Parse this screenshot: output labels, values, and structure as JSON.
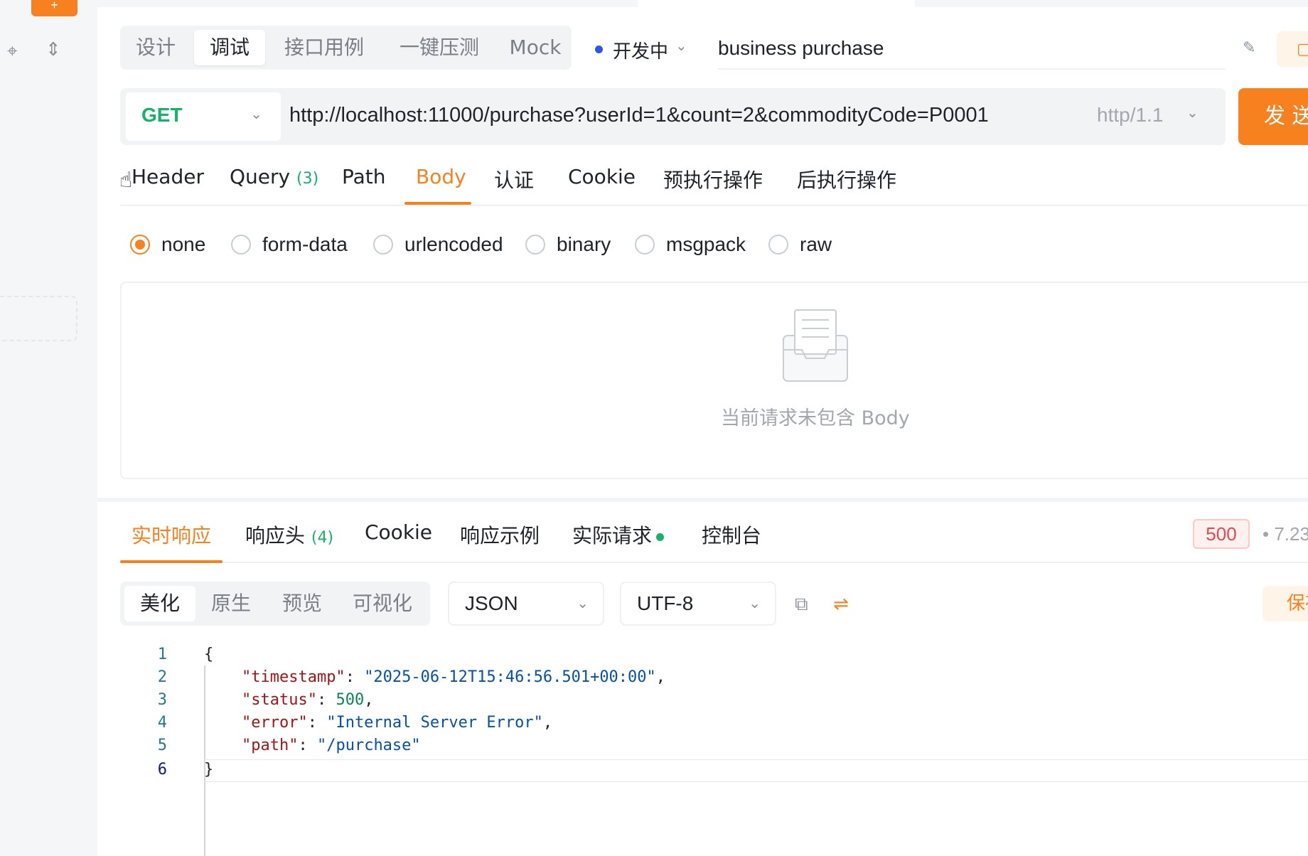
{
  "mode_tabs": [
    "设计",
    "调试",
    "接口用例",
    "一键压测",
    "Mock"
  ],
  "active_mode": "调试",
  "environment": "开发中",
  "api_name": "business purchase",
  "request": {
    "method": "GET",
    "url": "http://localhost:11000/purchase?userId=1&count=2&commodityCode=P0001",
    "http_version": "http/1.1",
    "send_label": "发 送"
  },
  "request_tabs": [
    {
      "label": "Header",
      "count": ""
    },
    {
      "label": "Query",
      "count": "(3)"
    },
    {
      "label": "Path",
      "count": ""
    },
    {
      "label": "Body",
      "count": ""
    },
    {
      "label": "认证",
      "count": ""
    },
    {
      "label": "Cookie",
      "count": ""
    },
    {
      "label": "预执行操作",
      "count": ""
    },
    {
      "label": "后执行操作",
      "count": ""
    }
  ],
  "active_request_tab": "Body",
  "body_types": [
    "none",
    "form-data",
    "urlencoded",
    "binary",
    "msgpack",
    "raw"
  ],
  "selected_body_type": "none",
  "body_empty_message": "当前请求未包含 Body",
  "response_tabs": [
    {
      "label": "实时响应",
      "count": ""
    },
    {
      "label": "响应头",
      "count": "(4)"
    },
    {
      "label": "Cookie",
      "count": ""
    },
    {
      "label": "响应示例",
      "count": ""
    },
    {
      "label": "实际请求",
      "count": ""
    },
    {
      "label": "控制台",
      "count": ""
    }
  ],
  "active_response_tab": "实时响应",
  "response_status": "500",
  "response_time": "7.23",
  "view_tabs": [
    "美化",
    "原生",
    "预览",
    "可视化"
  ],
  "active_view": "美化",
  "format_select": "JSON",
  "encoding_select": "UTF-8",
  "save_label": "保存",
  "code_lines": {
    "l1": "{",
    "l2_key": "\"timestamp\"",
    "l2_val": "\"2025-06-12T15:46:56.501+00:00\"",
    "l3_key": "\"status\"",
    "l3_val": "500",
    "l4_key": "\"error\"",
    "l4_val": "\"Internal Server Error\"",
    "l5_key": "\"path\"",
    "l5_val": "\"/purchase\"",
    "l6": "}"
  },
  "line_numbers": [
    "1",
    "2",
    "3",
    "4",
    "5",
    "6"
  ],
  "colors": {
    "accent": "#f7811f",
    "get_method": "#17b26a",
    "error": "#e5484d"
  }
}
